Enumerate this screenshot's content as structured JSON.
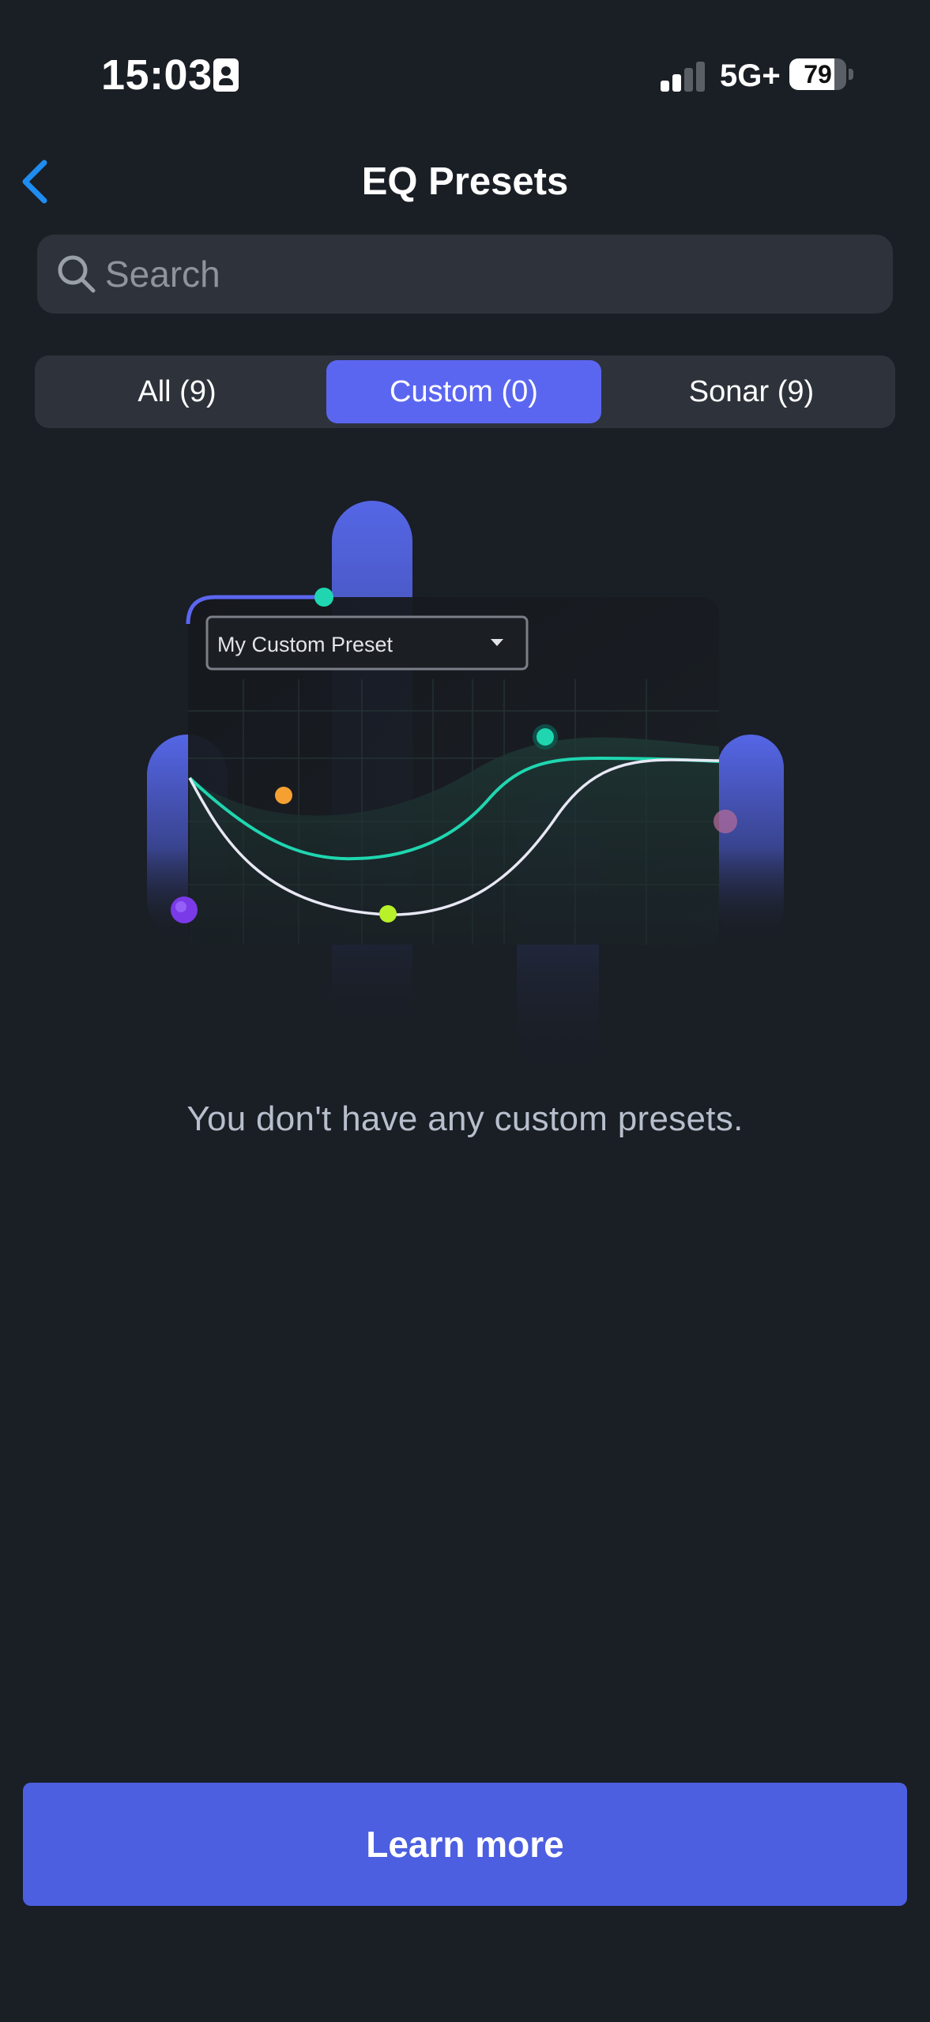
{
  "status_bar": {
    "time": "15:03",
    "network": "5G+",
    "battery": "79",
    "battery_level": 0.79,
    "signal_bars_active": 2,
    "signal_bars_total": 4
  },
  "nav": {
    "title": "EQ Presets",
    "back_icon": "chevron-left-icon",
    "accent_color": "#1e8cf0"
  },
  "search": {
    "placeholder": "Search",
    "value": "",
    "icon": "search-icon"
  },
  "tabs": [
    {
      "label": "All (9)",
      "active": false
    },
    {
      "label": "Custom (0)",
      "active": true
    },
    {
      "label": "Sonar (9)",
      "active": false
    }
  ],
  "illustration": {
    "dropdown_label": "My Custom Preset",
    "dropdown_icon": "caret-down-icon"
  },
  "empty_state": {
    "message": "You don't have any custom presets."
  },
  "footer": {
    "learn_more_label": "Learn more"
  },
  "colors": {
    "background": "#1a1e25",
    "surface": "#2e333b",
    "accent": "#5b66f0",
    "button": "#4c5fe0",
    "curve_teal": "#1fd6b0",
    "curve_white": "#e8e8f4"
  }
}
